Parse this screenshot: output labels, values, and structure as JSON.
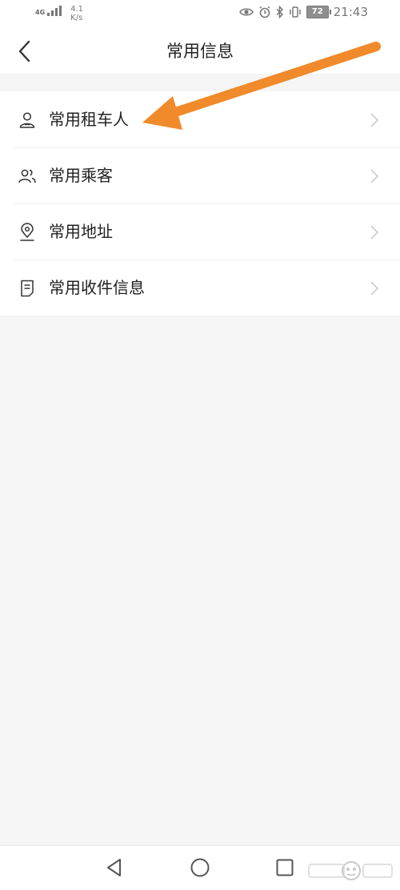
{
  "status_bar": {
    "network": "4G",
    "speed_value": "4.1",
    "speed_unit": "K/s",
    "battery": "72",
    "time": "21:43"
  },
  "header": {
    "title": "常用信息",
    "back_icon": "chevron-left-icon"
  },
  "menu": {
    "items": [
      {
        "label": "常用租车人",
        "icon": "person-icon"
      },
      {
        "label": "常用乘客",
        "icon": "people-icon"
      },
      {
        "label": "常用地址",
        "icon": "location-pin-icon"
      },
      {
        "label": "常用收件信息",
        "icon": "document-icon"
      }
    ]
  },
  "annotation": {
    "color": "#f08a2a"
  },
  "colors": {
    "background": "#f5f5f5",
    "card": "#ffffff",
    "text": "#222222",
    "chevron": "#cccccc"
  }
}
